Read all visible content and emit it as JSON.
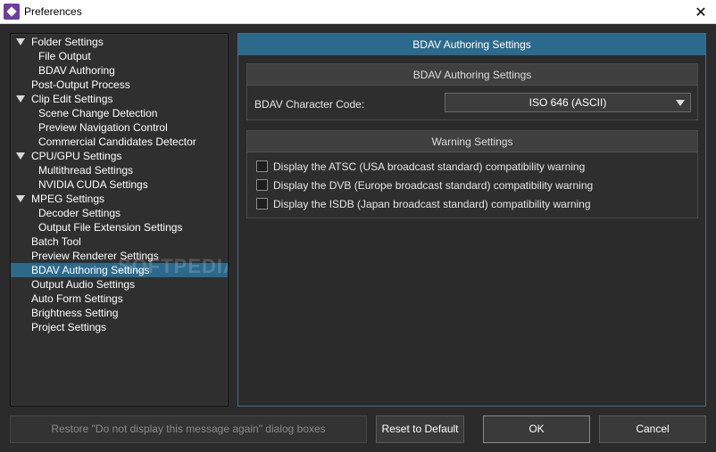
{
  "window": {
    "title": "Preferences",
    "close_glyph": "✕"
  },
  "tree": {
    "items": [
      {
        "label": "Folder Settings",
        "level": 0,
        "expanded": true
      },
      {
        "label": "File Output",
        "level": 1
      },
      {
        "label": "BDAV Authoring",
        "level": 1
      },
      {
        "label": "Post-Output Process",
        "level": 0
      },
      {
        "label": "Clip Edit Settings",
        "level": 0,
        "expanded": true
      },
      {
        "label": "Scene Change Detection",
        "level": 1
      },
      {
        "label": "Preview Navigation Control",
        "level": 1
      },
      {
        "label": "Commercial Candidates Detector",
        "level": 1
      },
      {
        "label": "CPU/GPU Settings",
        "level": 0,
        "expanded": true
      },
      {
        "label": "Multithread Settings",
        "level": 1
      },
      {
        "label": "NVIDIA CUDA Settings",
        "level": 1
      },
      {
        "label": "MPEG Settings",
        "level": 0,
        "expanded": true
      },
      {
        "label": "Decoder Settings",
        "level": 1
      },
      {
        "label": "Output File Extension Settings",
        "level": 1
      },
      {
        "label": "Batch Tool",
        "level": 0
      },
      {
        "label": "Preview Renderer Settings",
        "level": 0
      },
      {
        "label": "BDAV Authoring Settings",
        "level": 0,
        "selected": true
      },
      {
        "label": "Output Audio Settings",
        "level": 0
      },
      {
        "label": "Auto Form Settings",
        "level": 0
      },
      {
        "label": "Brightness Setting",
        "level": 0
      },
      {
        "label": "Project Settings",
        "level": 0
      }
    ],
    "watermark": "SOFTPEDIA"
  },
  "panel": {
    "title": "BDAV Authoring Settings",
    "bdav_group": {
      "title": "BDAV Authoring Settings",
      "char_code_label": "BDAV Character Code:",
      "char_code_value": "ISO 646 (ASCII)"
    },
    "warning_group": {
      "title": "Warning Settings",
      "checks": [
        {
          "label": "Display the ATSC (USA broadcast standard) compatibility warning",
          "checked": false
        },
        {
          "label": "Display the DVB (Europe broadcast standard) compatibility warning",
          "checked": false
        },
        {
          "label": "Display the ISDB (Japan broadcast standard) compatibility warning",
          "checked": false
        }
      ]
    }
  },
  "buttons": {
    "restore": "Restore \"Do not display this message again\" dialog boxes",
    "reset": "Reset to Default",
    "ok": "OK",
    "cancel": "Cancel"
  },
  "colors": {
    "accent": "#2b6a8c",
    "background": "#2b2b2b"
  }
}
